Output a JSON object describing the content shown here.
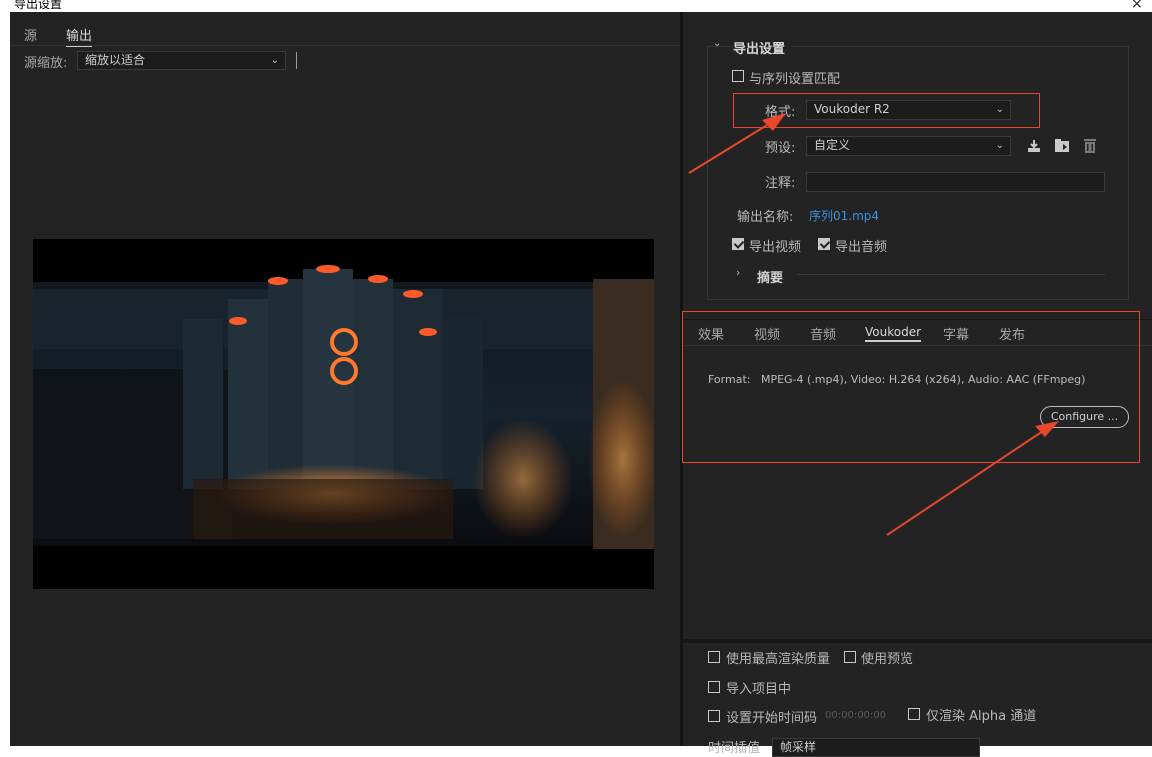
{
  "window": {
    "title": "导出设置",
    "close_glyph": "×"
  },
  "left": {
    "tabs": [
      "源",
      "输出"
    ],
    "source_scale_label": "源缩放:",
    "source_scale_value": "缩放以适合"
  },
  "export_settings": {
    "section_title": "导出设置",
    "match_sequence_label": "与序列设置匹配",
    "format_label": "格式:",
    "format_value": "Voukoder R2",
    "preset_label": "预设:",
    "preset_value": "自定义",
    "comment_label": "注释:",
    "comment_value": "",
    "output_name_label": "输出名称:",
    "output_name_value": "序列01.mp4",
    "export_video_label": "导出视频",
    "export_audio_label": "导出音频",
    "summary_label": "摘要"
  },
  "settings_tabs": [
    "效果",
    "视频",
    "音频",
    "Voukoder",
    "字幕",
    "发布"
  ],
  "voukoder": {
    "format_text": "Format:   MPEG-4 (.mp4), Video: H.264 (x264), Audio: AAC (FFmpeg)",
    "configure_label": "Configure ..."
  },
  "bottom": {
    "max_render_quality_label": "使用最高渲染质量",
    "use_preview_label": "使用预览",
    "import_into_project_label": "导入项目中",
    "set_start_timecode_label": "设置开始时间码",
    "start_timecode_value": "00:00:00:00",
    "render_alpha_label": "仅渲染 Alpha 通道",
    "time_interpolation_label": "时间插值",
    "time_interpolation_value": "帧采样"
  },
  "colors": {
    "accent_red": "#e8472c",
    "panel_bg": "#232323",
    "link_blue": "#3d8fe0"
  },
  "icons": [
    "save-preset-icon",
    "import-preset-icon",
    "delete-preset-icon",
    "chevron-down-icon",
    "checkbox-icon"
  ]
}
